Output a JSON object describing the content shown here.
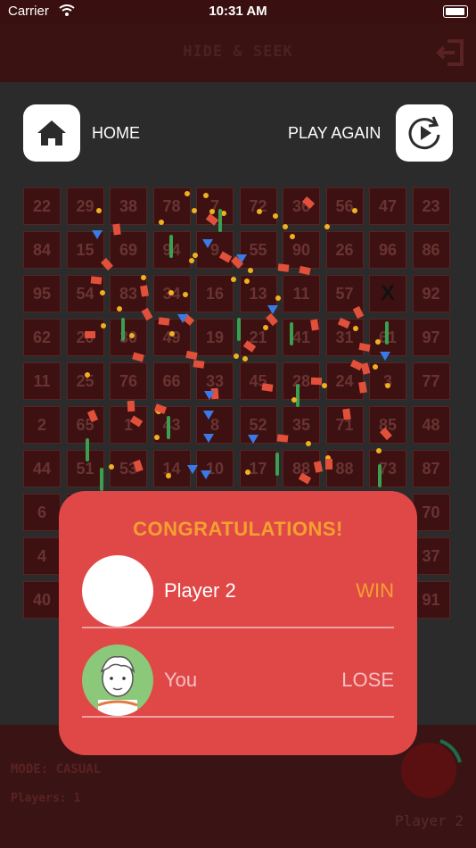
{
  "status": {
    "carrier": "Carrier",
    "time": "10:31 AM"
  },
  "header": {
    "title": "HIDE & SEEK",
    "exit_icon": "exit-icon"
  },
  "actions": {
    "home_label": "HOME",
    "play_again_label": "PLAY AGAIN"
  },
  "board": {
    "rows": [
      [
        "22",
        "29",
        "38",
        "78",
        "7",
        "72",
        "36",
        "56",
        "47",
        "23"
      ],
      [
        "84",
        "15",
        "69",
        "94",
        "9",
        "55",
        "90",
        "26",
        "96",
        "86"
      ],
      [
        "95",
        "54",
        "83",
        "34",
        "16",
        "13",
        "11",
        "57",
        "X",
        "92"
      ],
      [
        "62",
        "20",
        "30",
        "49",
        "19",
        "21",
        "41",
        "31",
        "61",
        "97"
      ],
      [
        "11",
        "25",
        "76",
        "66",
        "33",
        "45",
        "28",
        "24",
        "3",
        "77"
      ],
      [
        "2",
        "65",
        "1",
        "43",
        "8",
        "52",
        "35",
        "71",
        "85",
        "48"
      ],
      [
        "44",
        "51",
        "53",
        "14",
        "10",
        "17",
        "88",
        "88",
        "73",
        "87"
      ],
      [
        "6",
        "",
        "",
        "",
        "",
        "",
        "",
        "",
        "",
        "70"
      ],
      [
        "4",
        "",
        "",
        "",
        "",
        "",
        "",
        "",
        "",
        "37"
      ],
      [
        "40",
        "",
        "",
        "",
        "",
        "",
        "",
        "",
        "",
        "91"
      ]
    ]
  },
  "result_modal": {
    "title": "CONGRATULATIONS!",
    "players": [
      {
        "name": "Player 2",
        "result": "WIN"
      },
      {
        "name": "You",
        "result": "LOSE"
      }
    ]
  },
  "footer": {
    "mode": "MODE: CASUAL",
    "players": "Players: 1",
    "current_player": "Player 2"
  }
}
